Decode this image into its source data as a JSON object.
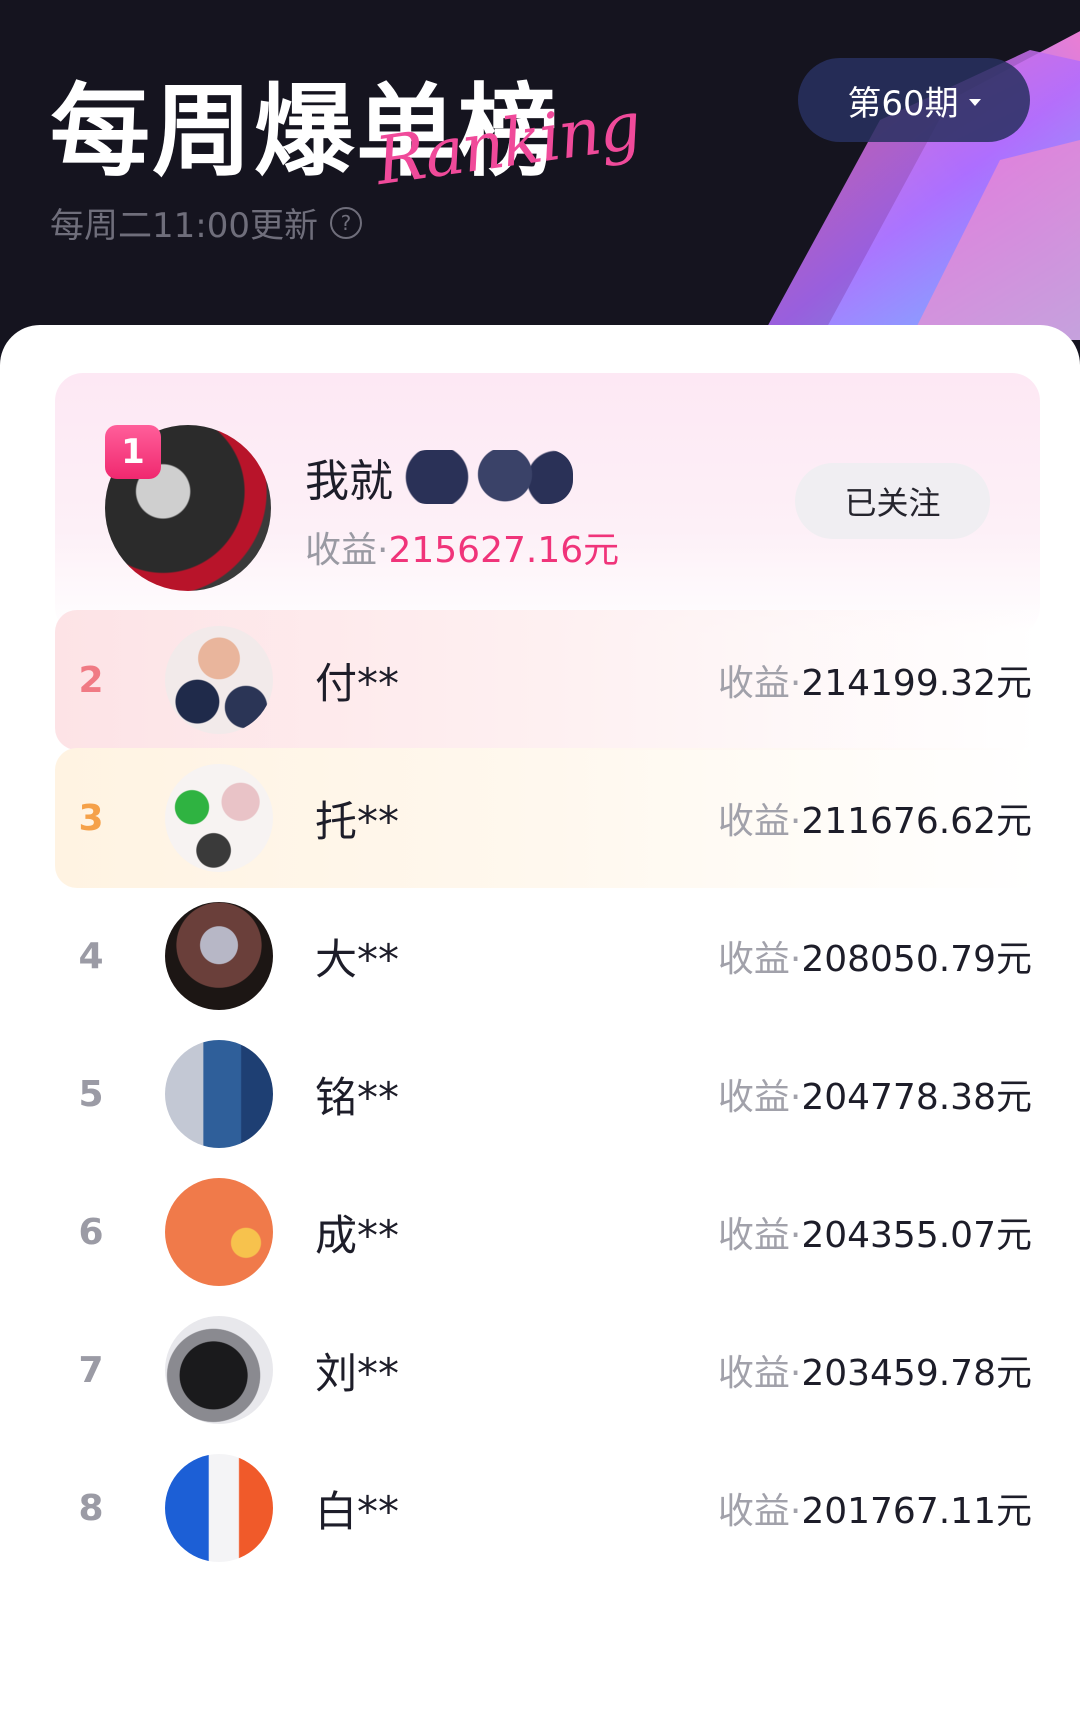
{
  "header": {
    "title": "每周爆单榜",
    "title_decor": "Ranking",
    "subtitle": "每周二11:00更新",
    "period": "第60期"
  },
  "first": {
    "rank": "1",
    "name": "我就",
    "earn_label": "收益·",
    "earn_value": "215627.16元",
    "follow_label": "已关注"
  },
  "rows": [
    {
      "rank": "2",
      "name": "付**",
      "earn_label": "收益·",
      "earn_value": "214199.32元"
    },
    {
      "rank": "3",
      "name": "托**",
      "earn_label": "收益·",
      "earn_value": "211676.62元"
    },
    {
      "rank": "4",
      "name": "大**",
      "earn_label": "收益·",
      "earn_value": "208050.79元"
    },
    {
      "rank": "5",
      "name": "铭**",
      "earn_label": "收益·",
      "earn_value": "204778.38元"
    },
    {
      "rank": "6",
      "name": "成**",
      "earn_label": "收益·",
      "earn_value": "204355.07元"
    },
    {
      "rank": "7",
      "name": "刘**",
      "earn_label": "收益·",
      "earn_value": "203459.78元"
    },
    {
      "rank": "8",
      "name": "白**",
      "earn_label": "收益·",
      "earn_value": "201767.11元"
    }
  ],
  "colors": {
    "accent_pink": "#f0347a",
    "rank2": "#f07a84",
    "rank3": "#f5a14a",
    "header_bg": "#15141f"
  }
}
